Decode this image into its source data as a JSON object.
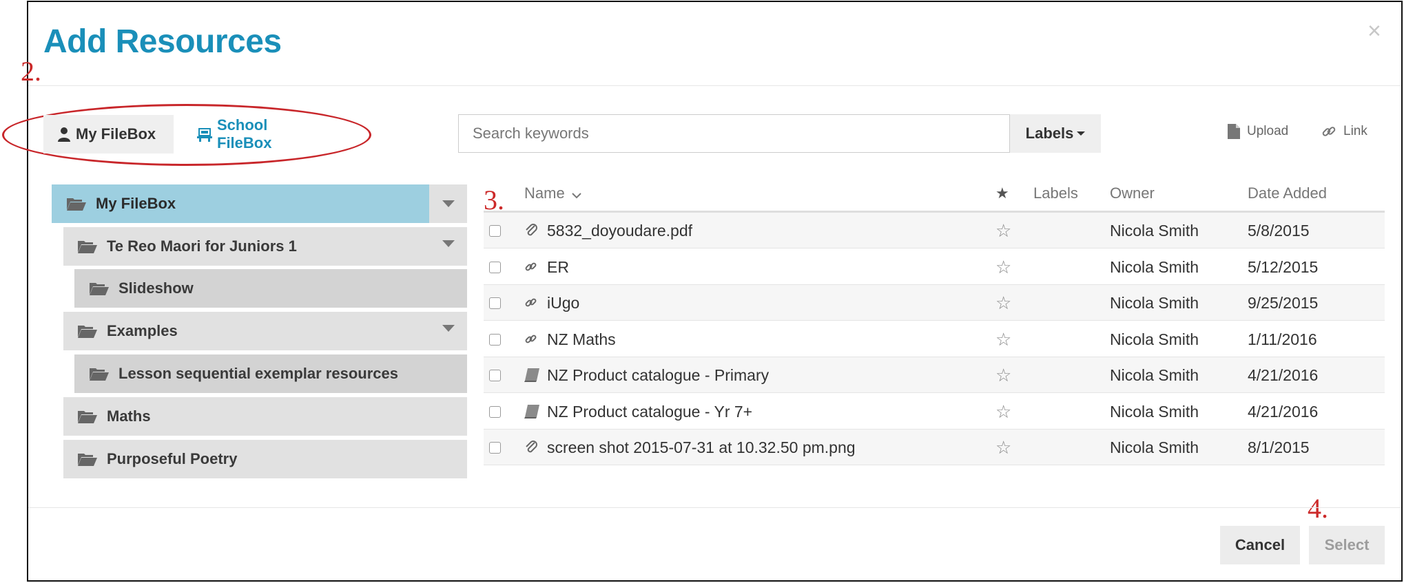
{
  "dialog": {
    "title": "Add Resources",
    "close_glyph": "×"
  },
  "annotations": {
    "a2": "2.",
    "a3": "3.",
    "a4": "4.",
    "color": "#cc2a2a"
  },
  "tabs": [
    {
      "label": "My FileBox",
      "icon": "user-icon",
      "active": true
    },
    {
      "label": "School FileBox",
      "icon": "school-icon",
      "active": false
    }
  ],
  "search": {
    "placeholder": "Search keywords",
    "value": ""
  },
  "labels_button": {
    "label": "Labels"
  },
  "actions": {
    "upload": "Upload",
    "link": "Link"
  },
  "tree": [
    {
      "label": "My FileBox",
      "active": true,
      "expandable": true
    },
    {
      "label": "Te Reo Maori for Juniors 1",
      "expandable": true
    },
    {
      "label": "Slideshow",
      "expandable": false
    },
    {
      "label": "Examples",
      "expandable": true
    },
    {
      "label": "Lesson sequential exemplar resources",
      "expandable": false
    },
    {
      "label": "Maths",
      "expandable": false
    },
    {
      "label": "Purposeful Poetry",
      "expandable": false
    }
  ],
  "table": {
    "columns": {
      "name": "Name",
      "star": "★",
      "labels": "Labels",
      "owner": "Owner",
      "date": "Date Added"
    },
    "star_glyph": "☆",
    "rows": [
      {
        "type": "file-icon",
        "name": "5832_doyoudare.pdf",
        "labels": "",
        "owner": "Nicola Smith",
        "date": "5/8/2015"
      },
      {
        "type": "link-icon",
        "name": "ER",
        "labels": "",
        "owner": "Nicola Smith",
        "date": "5/12/2015"
      },
      {
        "type": "link-icon",
        "name": "iUgo",
        "labels": "",
        "owner": "Nicola Smith",
        "date": "9/25/2015"
      },
      {
        "type": "link-icon",
        "name": "NZ Maths",
        "labels": "",
        "owner": "Nicola Smith",
        "date": "1/11/2016"
      },
      {
        "type": "book-icon",
        "name": "NZ Product catalogue - Primary",
        "labels": "",
        "owner": "Nicola Smith",
        "date": "4/21/2016"
      },
      {
        "type": "book-icon",
        "name": "NZ Product catalogue - Yr 7+",
        "labels": "",
        "owner": "Nicola Smith",
        "date": "4/21/2016"
      },
      {
        "type": "file-icon",
        "name": "screen shot 2015-07-31 at 10.32.50 pm.png",
        "labels": "",
        "owner": "Nicola Smith",
        "date": "8/1/2015"
      }
    ]
  },
  "footer": {
    "cancel": "Cancel",
    "select": "Select"
  },
  "colors": {
    "accent": "#1a8fb9",
    "tree_active": "#9dcfe0",
    "tree_item": "#e1e1e1",
    "annotation": "#cc2a2a"
  }
}
